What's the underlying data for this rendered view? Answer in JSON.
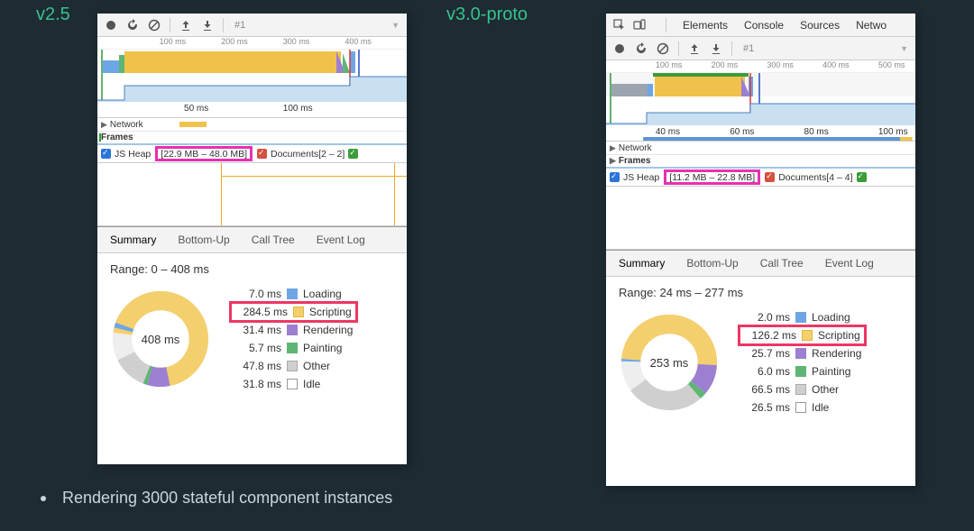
{
  "labels": {
    "v25": "v2.5",
    "v30": "v3.0-proto"
  },
  "bullet": "Rendering 3000 stateful component instances",
  "devtoolsTabs": {
    "elements": "Elements",
    "console": "Console",
    "sources": "Sources",
    "network": "Netwo"
  },
  "toolbar": {
    "tab": "#1",
    "caret": "▼"
  },
  "panelA": {
    "overviewTicks": [
      "100 ms",
      "200 ms",
      "300 ms",
      "400 ms"
    ],
    "timelineTicks": [
      "50 ms",
      "100 ms"
    ],
    "tracks": {
      "network": "Network",
      "frames": "Frames"
    },
    "counters": {
      "jsheap": "JS Heap",
      "heapRange": "[22.9 MB – 48.0 MB]",
      "documents": "Documents[2 – 2]"
    },
    "sumTabs": {
      "summary": "Summary",
      "bottomUp": "Bottom-Up",
      "callTree": "Call Tree",
      "eventLog": "Event Log"
    },
    "range": "Range: 0 – 408 ms",
    "donutCenter": "408 ms",
    "legend": {
      "loading": {
        "val": "7.0 ms",
        "label": "Loading"
      },
      "scripting": {
        "val": "284.5 ms",
        "label": "Scripting"
      },
      "rendering": {
        "val": "31.4 ms",
        "label": "Rendering"
      },
      "painting": {
        "val": "5.7 ms",
        "label": "Painting"
      },
      "other": {
        "val": "47.8 ms",
        "label": "Other"
      },
      "idle": {
        "val": "31.8 ms",
        "label": "Idle"
      }
    }
  },
  "panelB": {
    "overviewTicks": [
      "100 ms",
      "200 ms",
      "300 ms",
      "400 ms",
      "500 ms"
    ],
    "timelineTicks": [
      "40 ms",
      "60 ms",
      "80 ms",
      "100 ms"
    ],
    "tracks": {
      "network": "Network",
      "frames": "Frames"
    },
    "counters": {
      "jsheap": "JS Heap",
      "heapRange": "[11.2 MB – 22.8 MB]",
      "documents": "Documents[4 – 4]"
    },
    "sumTabs": {
      "summary": "Summary",
      "bottomUp": "Bottom-Up",
      "callTree": "Call Tree",
      "eventLog": "Event Log"
    },
    "range": "Range: 24 ms – 277 ms",
    "donutCenter": "253 ms",
    "legend": {
      "loading": {
        "val": "2.0 ms",
        "label": "Loading"
      },
      "scripting": {
        "val": "126.2 ms",
        "label": "Scripting"
      },
      "rendering": {
        "val": "25.7 ms",
        "label": "Rendering"
      },
      "painting": {
        "val": "6.0 ms",
        "label": "Painting"
      },
      "other": {
        "val": "66.5 ms",
        "label": "Other"
      },
      "idle": {
        "val": "26.5 ms",
        "label": "Idle"
      }
    }
  },
  "chart_data": [
    {
      "type": "pie",
      "title": "v2.5 – Summary (0–408 ms)",
      "total_ms": 408,
      "series": [
        {
          "name": "Loading",
          "value": 7.0,
          "color": "#6da6e5"
        },
        {
          "name": "Scripting",
          "value": 284.5,
          "color": "#f4cf6e"
        },
        {
          "name": "Rendering",
          "value": 31.4,
          "color": "#9d7fd1"
        },
        {
          "name": "Painting",
          "value": 5.7,
          "color": "#5fb574"
        },
        {
          "name": "Other",
          "value": 47.8,
          "color": "#cfcfcf"
        },
        {
          "name": "Idle",
          "value": 31.8,
          "color": "#ffffff"
        }
      ]
    },
    {
      "type": "pie",
      "title": "v3.0-proto – Summary (24–277 ms)",
      "total_ms": 253,
      "series": [
        {
          "name": "Loading",
          "value": 2.0,
          "color": "#6da6e5"
        },
        {
          "name": "Scripting",
          "value": 126.2,
          "color": "#f4cf6e"
        },
        {
          "name": "Rendering",
          "value": 25.7,
          "color": "#9d7fd1"
        },
        {
          "name": "Painting",
          "value": 6.0,
          "color": "#5fb574"
        },
        {
          "name": "Other",
          "value": 66.5,
          "color": "#cfcfcf"
        },
        {
          "name": "Idle",
          "value": 26.5,
          "color": "#ffffff"
        }
      ]
    }
  ]
}
